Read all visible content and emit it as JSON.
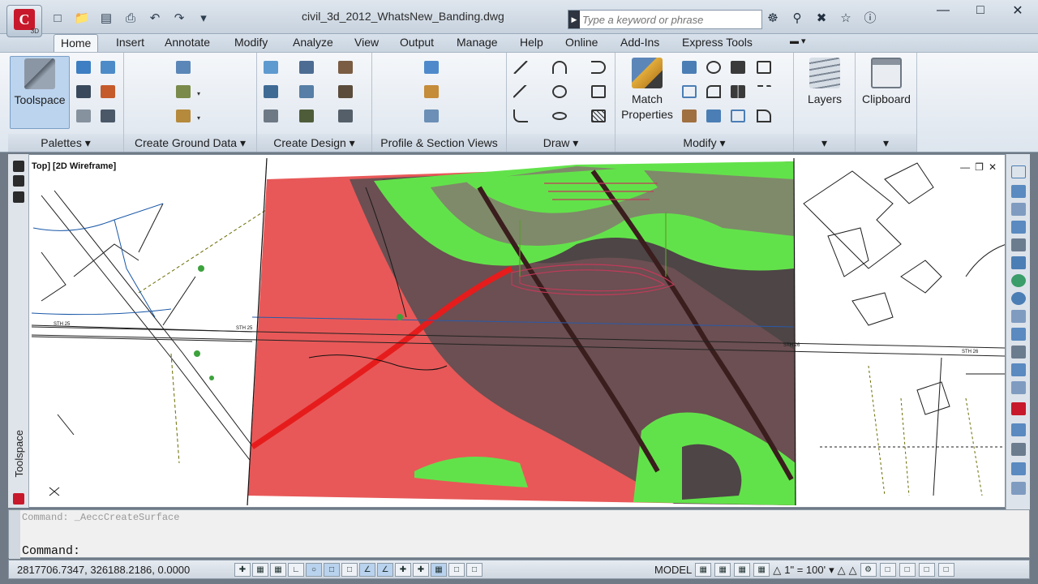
{
  "app": {
    "logo_text": "C",
    "logo_tag": "3D",
    "window_title": "civil_3d_2012_WhatsNew_Banding.dwg"
  },
  "quick_access": [
    "new-icon",
    "open-icon",
    "save-icon",
    "plot-icon",
    "undo-icon",
    "redo-icon"
  ],
  "search": {
    "placeholder": "Type a keyword or phrase"
  },
  "toolbar_icons": [
    "binoculars-icon",
    "key-icon",
    "tools-icon",
    "star-icon",
    "help-icon"
  ],
  "tabs": [
    "Home",
    "Insert",
    "Annotate",
    "Modify",
    "Analyze",
    "View",
    "Output",
    "Manage",
    "Help",
    "Online",
    "Add-Ins",
    "Express Tools"
  ],
  "active_tab": "Home",
  "panels": {
    "palettes": {
      "label": "Palettes",
      "big_button": "Toolspace"
    },
    "ground": {
      "label": "Create Ground Data"
    },
    "design": {
      "label": "Create Design"
    },
    "profile": {
      "label": "Profile & Section Views"
    },
    "draw": {
      "label": "Draw"
    },
    "modify": {
      "label": "Modify",
      "big_button": "Match Properties"
    },
    "layers": {
      "label": "Layers"
    },
    "clipboard": {
      "label": "Clipboard"
    }
  },
  "viewport": {
    "label": "Top] [2D Wireframe]"
  },
  "palette": {
    "title": "Toolspace"
  },
  "drawing": {
    "road_labels": [
      "STH 25",
      "STH 25",
      "STH 26",
      "STH 26"
    ],
    "colors": {
      "cut": "#e64b4b",
      "fill": "#62e24a",
      "neutral": "#4d4546"
    }
  },
  "command": {
    "history": "Command: _AeccCreateSurface",
    "prompt": "Command:"
  },
  "status": {
    "coordinates": "2817706.7347, 326188.2186, 0.0000",
    "model": "MODEL",
    "scale": "1\" = 100'"
  }
}
